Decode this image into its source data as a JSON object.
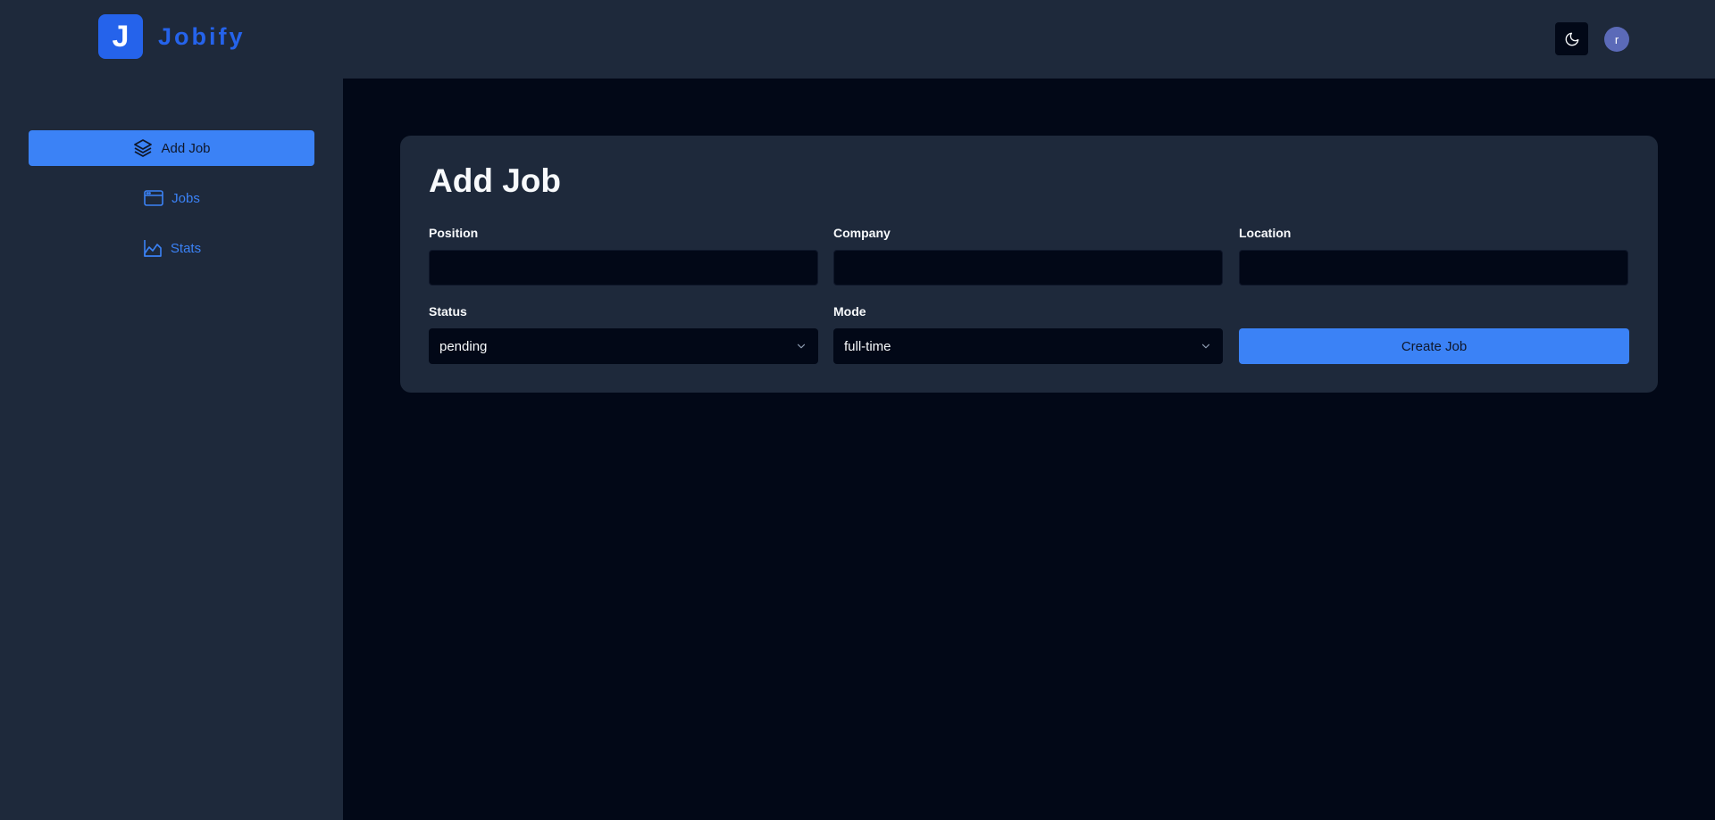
{
  "brand": {
    "mark": "J",
    "name": "Jobify"
  },
  "sidebar": {
    "items": [
      {
        "label": "Add Job",
        "icon": "layers-icon",
        "active": true
      },
      {
        "label": "Jobs",
        "icon": "browser-window-icon",
        "active": false
      },
      {
        "label": "Stats",
        "icon": "area-chart-icon",
        "active": false
      }
    ]
  },
  "header": {
    "theme_icon": "moon-icon",
    "avatar_initial": "r"
  },
  "form": {
    "title": "Add Job",
    "position": {
      "label": "Position",
      "value": ""
    },
    "company": {
      "label": "Company",
      "value": ""
    },
    "location": {
      "label": "Location",
      "value": ""
    },
    "status": {
      "label": "Status",
      "value": "pending"
    },
    "mode": {
      "label": "Mode",
      "value": "full-time"
    },
    "submit_label": "Create Job"
  },
  "colors": {
    "accent": "#3b82f6",
    "brand": "#2563eb",
    "panel": "#1e293b",
    "background": "#020817"
  }
}
